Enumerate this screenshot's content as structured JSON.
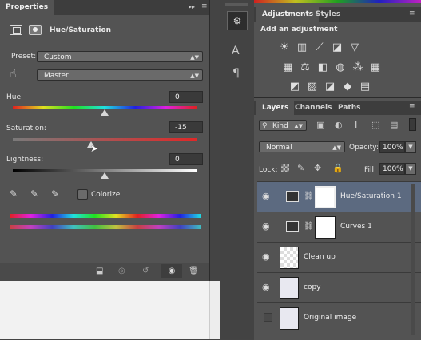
{
  "properties": {
    "tab_label": "Properties",
    "panel_title": "Hue/Saturation",
    "preset_label": "Preset:",
    "preset_value": "Custom",
    "channel_value": "Master",
    "hue_label": "Hue:",
    "hue_value": "0",
    "saturation_label": "Saturation:",
    "saturation_value": "-15",
    "lightness_label": "Lightness:",
    "lightness_value": "0",
    "colorize_label": "Colorize",
    "colorize_checked": false
  },
  "adjustments": {
    "tabs": [
      "Adjustments",
      "Styles"
    ],
    "heading": "Add an adjustment",
    "icons_row1": [
      "brightness-icon",
      "levels-icon",
      "curves-icon",
      "exposure-icon",
      "vibrance-icon"
    ],
    "icons_row2": [
      "hue-saturation-icon",
      "color-balance-icon",
      "black-white-icon",
      "photo-filter-icon",
      "channel-mixer-icon",
      "color-lookup-icon"
    ],
    "icons_row3": [
      "invert-icon",
      "posterize-icon",
      "threshold-icon",
      "selective-color-icon",
      "gradient-map-icon"
    ]
  },
  "layers": {
    "tabs": [
      "Layers",
      "Channels",
      "Paths"
    ],
    "filter_label": "Kind",
    "blend_mode": "Normal",
    "opacity_label": "Opacity:",
    "opacity_value": "100%",
    "lock_label": "Lock:",
    "fill_label": "Fill:",
    "fill_value": "100%",
    "items": [
      {
        "name": "Hue/Saturation 1",
        "visible": true,
        "selected": true
      },
      {
        "name": "Curves 1",
        "visible": true,
        "selected": false
      },
      {
        "name": "Clean up",
        "visible": true,
        "selected": false
      },
      {
        "name": "copy",
        "visible": true,
        "selected": false
      },
      {
        "name": "Original image",
        "visible": false,
        "selected": false
      }
    ]
  },
  "colors": {
    "panel": "#535353",
    "selected_layer": "#5c6a80",
    "accent_red": "#e03030"
  }
}
